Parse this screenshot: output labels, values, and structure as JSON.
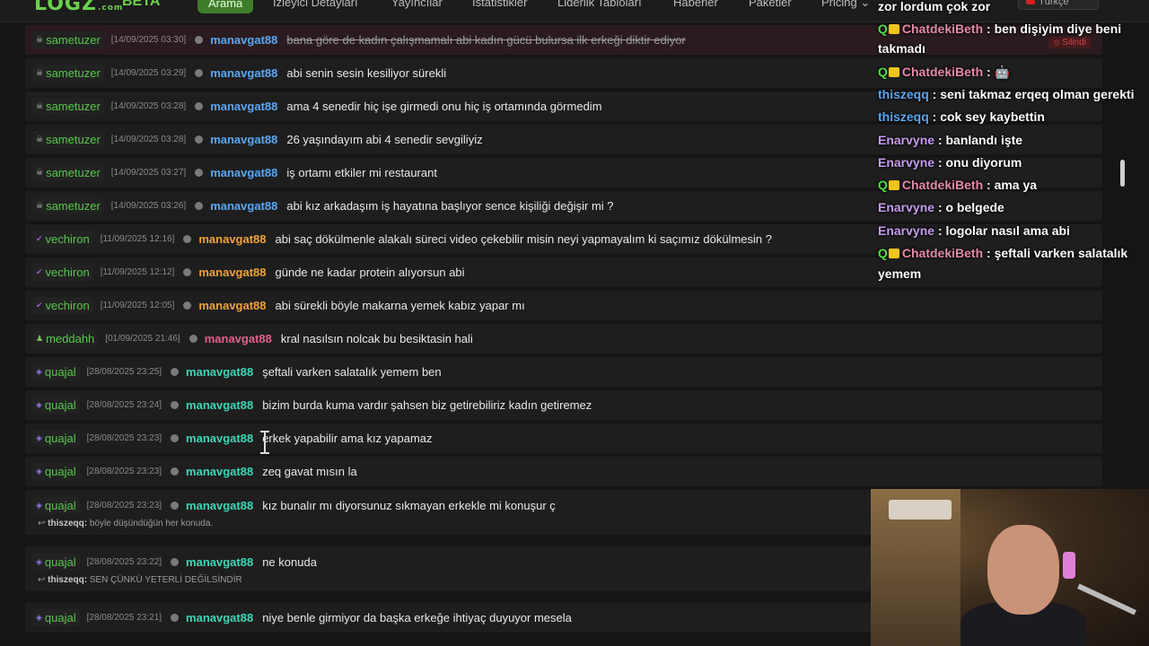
{
  "nav": {
    "logo": "LOGZ",
    "logo_suffix": ".com",
    "beta": "BETA",
    "items": [
      "Arama",
      "İzleyici Detayları",
      "Yayıncılar",
      "İstatistikler",
      "Liderlik Tabloları",
      "Haberler",
      "Paketler",
      "Pricing ⌄"
    ],
    "language": "Türkçe"
  },
  "colors": {
    "accent": "#3f7d2a",
    "username": "#55c94a",
    "cyan_user": "#3dd6b5",
    "orange_user": "#f0a23a",
    "pink_user": "#e0608a",
    "strike": "#9a9a9a"
  },
  "messages": [
    {
      "user": "sametuzer",
      "badge": "skull-icon",
      "ts": "[14/09/2025 03:30]",
      "target": "manavgat88",
      "target_color": "#5aa7f2",
      "text": "bana göre de kadın çalışmamalı abi kadın gücü bulursa ilk erkeği diktir ediyor",
      "deleted": true
    },
    {
      "user": "sametuzer",
      "badge": "skull-icon",
      "ts": "[14/09/2025 03:29]",
      "target": "manavgat88",
      "target_color": "#5aa7f2",
      "text": "abi senin sesin kesiliyor sürekli"
    },
    {
      "user": "sametuzer",
      "badge": "skull-icon",
      "ts": "[14/09/2025 03:28]",
      "target": "manavgat88",
      "target_color": "#5aa7f2",
      "text": "ama 4 senedir hiç işe girmedi onu hiç iş ortamında görmedim"
    },
    {
      "user": "sametuzer",
      "badge": "skull-icon",
      "ts": "[14/09/2025 03:28]",
      "target": "manavgat88",
      "target_color": "#5aa7f2",
      "text": "26 yaşındayım abi 4 senedir sevgiliyiz"
    },
    {
      "user": "sametuzer",
      "badge": "skull-icon",
      "ts": "[14/09/2025 03:27]",
      "target": "manavgat88",
      "target_color": "#5aa7f2",
      "text": "iş ortamı etkiler mi restaurant"
    },
    {
      "user": "sametuzer",
      "badge": "skull-icon",
      "ts": "[14/09/2025 03:26]",
      "target": "manavgat88",
      "target_color": "#5aa7f2",
      "text": "abi kız arkadaşım iş hayatına başlıyor sence kişiliği değişir mi ?"
    },
    {
      "user": "vechiron",
      "badge": "check-icon",
      "ts": "[11/09/2025 12:16]",
      "target": "manavgat88",
      "target_color": "#f0a23a",
      "text": "abi saç dökülmenle alakalı süreci video çekebilir misin neyi yapmayalım ki saçımız dökülmesin ?"
    },
    {
      "user": "vechiron",
      "badge": "check-icon",
      "ts": "[11/09/2025 12:12]",
      "target": "manavgat88",
      "target_color": "#f0a23a",
      "text": "günde ne kadar protein alıyorsun abi"
    },
    {
      "user": "vechiron",
      "badge": "check-icon",
      "ts": "[11/09/2025 12:05]",
      "target": "manavgat88",
      "target_color": "#f0a23a",
      "text": "abi sürekli böyle makarna yemek kabız yapar mı"
    },
    {
      "user": "meddahh",
      "badge": "person-icon",
      "ts": "[01/09/2025 21:46]",
      "target": "manavgat88",
      "target_color": "#e0608a",
      "text": "kral nasılsın nolcak bu besiktasin hali"
    },
    {
      "user": "quajal",
      "badge": "gift-icon",
      "ts": "[28/08/2025 23:25]",
      "target": "manavgat88",
      "target_color": "#3dd6b5",
      "text": "şeftali varken salatalık yemem ben"
    },
    {
      "user": "quajal",
      "badge": "gift-icon",
      "ts": "[28/08/2025 23:24]",
      "target": "manavgat88",
      "target_color": "#3dd6b5",
      "text": "bizim burda kuma vardır şahsen biz getirebiliriz kadın getiremez"
    },
    {
      "user": "quajal",
      "badge": "gift-icon",
      "ts": "[28/08/2025 23:23]",
      "target": "manavgat88",
      "target_color": "#3dd6b5",
      "text": "erkek yapabilir ama kız yapamaz"
    },
    {
      "user": "quajal",
      "badge": "gift-icon",
      "ts": "[28/08/2025 23:23]",
      "target": "manavgat88",
      "target_color": "#3dd6b5",
      "text": "zeq gavat mısın la"
    },
    {
      "user": "quajal",
      "badge": "gift-icon",
      "ts": "[28/08/2025 23:23]",
      "target": "manavgat88",
      "target_color": "#3dd6b5",
      "text": "kız bunalır mı diyorsunuz sıkmayan erkekle mi konuşur ç",
      "reply_user": "thiszeqq:",
      "reply_text": "böyle düşündüğün her konuda."
    },
    {
      "user": "quajal",
      "badge": "gift-icon",
      "ts": "[28/08/2025 23:22]",
      "target": "manavgat88",
      "target_color": "#3dd6b5",
      "text": "ne konuda",
      "reply_user": "thiszeqq:",
      "reply_text": "SEN ÇÜNKÜ YETERLİ DEĞİLSİNDİR"
    },
    {
      "user": "quajal",
      "badge": "gift-icon",
      "ts": "[28/08/2025 23:21]",
      "target": "manavgat88",
      "target_color": "#3dd6b5",
      "text": "niye benle girmiyor da başka erkeğe ihtiyaç duyuyor mesela"
    }
  ],
  "deleted_label": "⦸ Silindi",
  "overlay": {
    "lines": [
      {
        "badges": false,
        "name": "",
        "name_class": "",
        "text": "zor lordum çok zor"
      },
      {
        "badges": true,
        "name": "ChatdekiBeth",
        "name_class": "n-pink",
        "text": ": ben dişiyim diye beni"
      },
      {
        "badges": false,
        "name": "",
        "name_class": "",
        "text": "takmadı"
      },
      {
        "badges": true,
        "name": "ChatdekiBeth",
        "name_class": "n-pink",
        "text": ": 🤖"
      },
      {
        "badges": false,
        "name": "thiszeqq",
        "name_class": "n-blue",
        "text": ": seni takmaz erqeq olman gerekti"
      },
      {
        "badges": false,
        "name": "thiszeqq",
        "name_class": "n-blue",
        "text": ": cok sey kaybettin"
      },
      {
        "badges": false,
        "name": "Enarvyne",
        "name_class": "n-purple",
        "text": ": banlandı işte"
      },
      {
        "badges": false,
        "name": "Enarvyne",
        "name_class": "n-purple",
        "text": ": onu diyorum"
      },
      {
        "badges": true,
        "name": "ChatdekiBeth",
        "name_class": "n-pink",
        "text": ": ama ya"
      },
      {
        "badges": false,
        "name": "Enarvyne",
        "name_class": "n-purple",
        "text": ": o belgede"
      },
      {
        "badges": false,
        "name": "Enarvyne",
        "name_class": "n-purple",
        "text": ": logolar nasıl ama abi"
      },
      {
        "badges": true,
        "name": "ChatdekiBeth",
        "name_class": "n-pink",
        "text": ": şeftali varken salatalık"
      },
      {
        "badges": false,
        "name": "",
        "name_class": "",
        "text": "yemem"
      }
    ],
    "q_badge": "Q"
  }
}
